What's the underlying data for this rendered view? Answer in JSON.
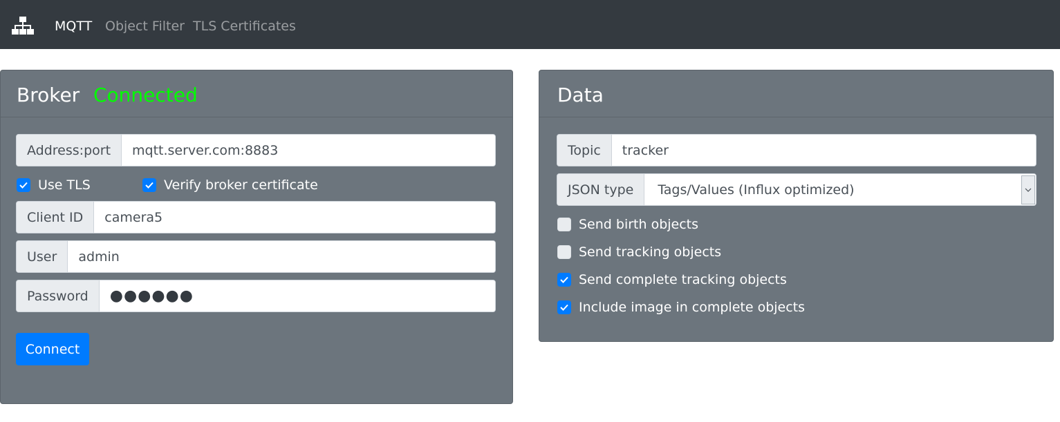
{
  "nav": {
    "logo_icon": "sitemap-icon",
    "items": [
      {
        "label": "MQTT",
        "active": true
      },
      {
        "label": "Object Filter",
        "active": false
      },
      {
        "label": "TLS Certificates",
        "active": false
      }
    ]
  },
  "broker": {
    "title": "Broker",
    "status": "Connected",
    "status_color": "#00ff00",
    "address": {
      "label": "Address:port",
      "value": "mqtt.server.com:8883"
    },
    "use_tls": {
      "label": "Use TLS",
      "checked": true
    },
    "verify_cert": {
      "label": "Verify broker certificate",
      "checked": true
    },
    "client_id": {
      "label": "Client ID",
      "value": "camera5"
    },
    "user": {
      "label": "User",
      "value": "admin"
    },
    "password": {
      "label": "Password",
      "value": "●●●●●●"
    },
    "connect_label": "Connect"
  },
  "data": {
    "title": "Data",
    "topic": {
      "label": "Topic",
      "value": "tracker"
    },
    "json_type": {
      "label": "JSON type",
      "value": "Tags/Values (Influx optimized)"
    },
    "checks": [
      {
        "label": "Send birth objects",
        "checked": false
      },
      {
        "label": "Send tracking objects",
        "checked": false
      },
      {
        "label": "Send complete tracking objects",
        "checked": true
      },
      {
        "label": "Include image in complete objects",
        "checked": true
      }
    ]
  },
  "colors": {
    "navbar": "#343a40",
    "card": "#6c757d",
    "primary": "#007bff"
  }
}
